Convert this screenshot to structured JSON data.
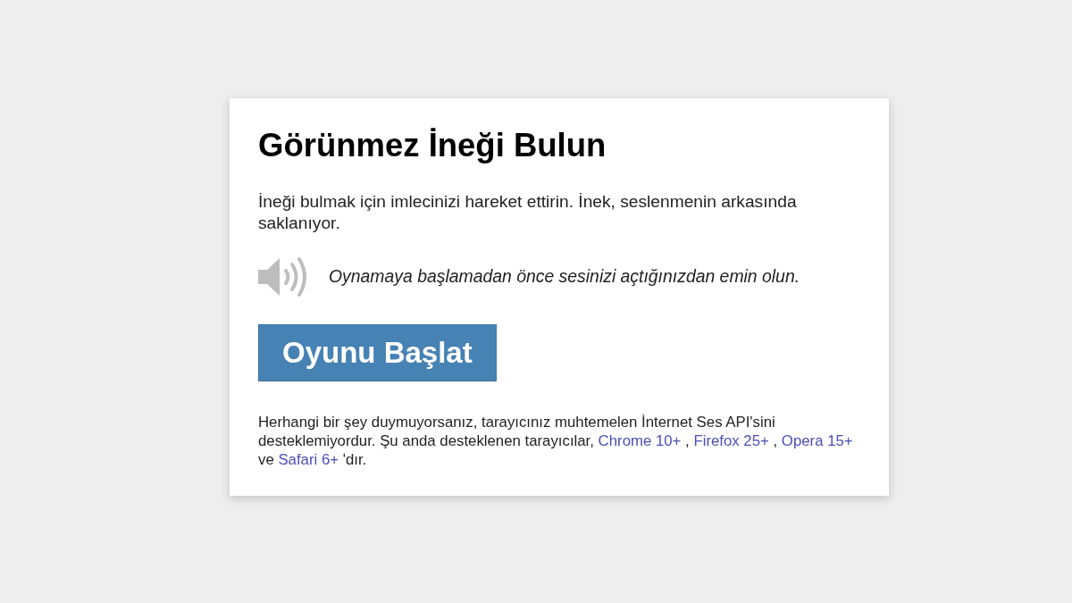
{
  "card": {
    "title": "Görünmez İneği Bulun",
    "intro": "İneği bulmak için imlecinizi hareket ettirin. İnek, seslenmenin arkasında saklanıyor.",
    "sound_notice": "Oynamaya başlamadan önce sesinizi açtığınızdan emin olun.",
    "start_button": "Oyunu Başlat",
    "footnote": [
      {
        "kind": "text",
        "text": "Herhangi bir şey duymuyorsanız, tarayıcınız muhtemelen İnternet Ses API'sini desteklemiyordur. Şu anda desteklenen tarayıcılar, "
      },
      {
        "kind": "link",
        "text": "Chrome 10+"
      },
      {
        "kind": "text",
        "text": " , "
      },
      {
        "kind": "link",
        "text": "Firefox 25+"
      },
      {
        "kind": "text",
        "text": " , "
      },
      {
        "kind": "link",
        "text": "Opera 15+"
      },
      {
        "kind": "text",
        "text": " ve "
      },
      {
        "kind": "link",
        "text": "Safari 6+"
      },
      {
        "kind": "text",
        "text": " 'dır."
      }
    ]
  }
}
